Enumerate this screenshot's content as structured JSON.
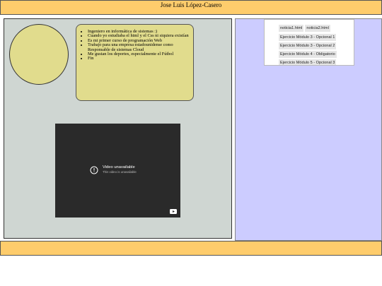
{
  "header": {
    "title": "Jose Luis López-Casero"
  },
  "bio": {
    "items": [
      "Ingeniero en informática de sistemas :)",
      "Cuando yo estudiaba el html y el Css ni siquiera existían",
      "Es mi primer curso de programación Web",
      "Trabajo para una empresa estadounidense como Responsable de sistemas Cloud",
      "Me gustan los deportes, especialmente el Fútbol",
      "Fin"
    ]
  },
  "video": {
    "title": "Video unavailable",
    "subtitle": "This video is unavailable",
    "icons": [
      "alert-circle-icon",
      "youtube-logo-icon"
    ]
  },
  "nav": {
    "row1": [
      "noticia1.html",
      "noticia2.html"
    ],
    "links": [
      "Ejercicio Módulo 3 - Opcional 1",
      "Ejercicio Módulo 3 - Opcional 2",
      "Ejercicio Módulo 4 - Obligatorio",
      "Ejercicio Módulo 5 - Opcional 3"
    ]
  },
  "colors": {
    "header_bg": "#fecc6c",
    "left_panel_bg": "#cfd6d2",
    "right_panel_bg": "#ccccff",
    "bio_bg": "#e1dc8d",
    "video_bg": "#2a2a2a"
  }
}
